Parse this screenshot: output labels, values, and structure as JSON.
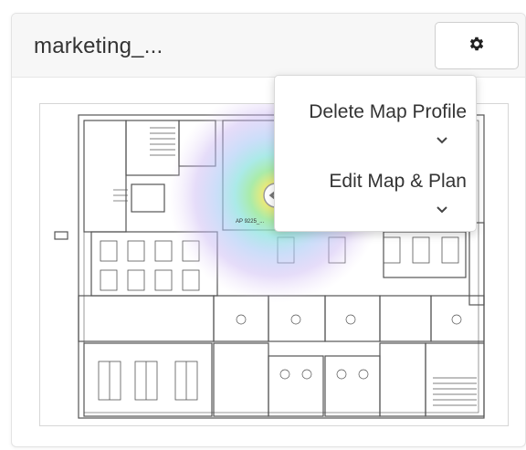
{
  "card": {
    "title": "marketing_...",
    "settings_icon": "gear-icon"
  },
  "map": {
    "ap_label": "AP 9225_...",
    "ap_icon": "access-point-icon",
    "heatmap_colors": [
      "#e6d6f5",
      "#c7b3f2",
      "#a9c8f5",
      "#8fe3e0",
      "#9be89b",
      "#e8e86b",
      "#f5c04a"
    ]
  },
  "menu": {
    "items": [
      {
        "label": "Delete Map Profile",
        "icon": "chevron-down-icon"
      },
      {
        "label": "Edit Map & Plan",
        "icon": "chevron-down-icon"
      }
    ]
  }
}
